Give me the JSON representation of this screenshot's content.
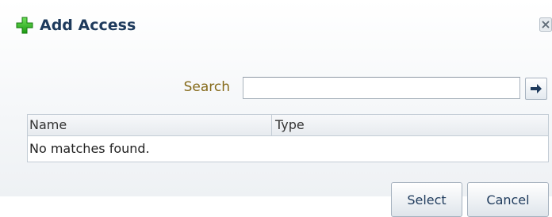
{
  "dialog": {
    "title": "Add Access",
    "title_icon": "plus-icon",
    "close_icon": "close-icon",
    "accent_color": "#2bb31f"
  },
  "search": {
    "label": "Search",
    "value": "",
    "placeholder": "",
    "go_icon": "arrow-right-icon"
  },
  "results": {
    "columns": [
      "Name",
      "Type"
    ],
    "empty_message": "No matches found."
  },
  "footer": {
    "select_label": "Select",
    "cancel_label": "Cancel"
  }
}
